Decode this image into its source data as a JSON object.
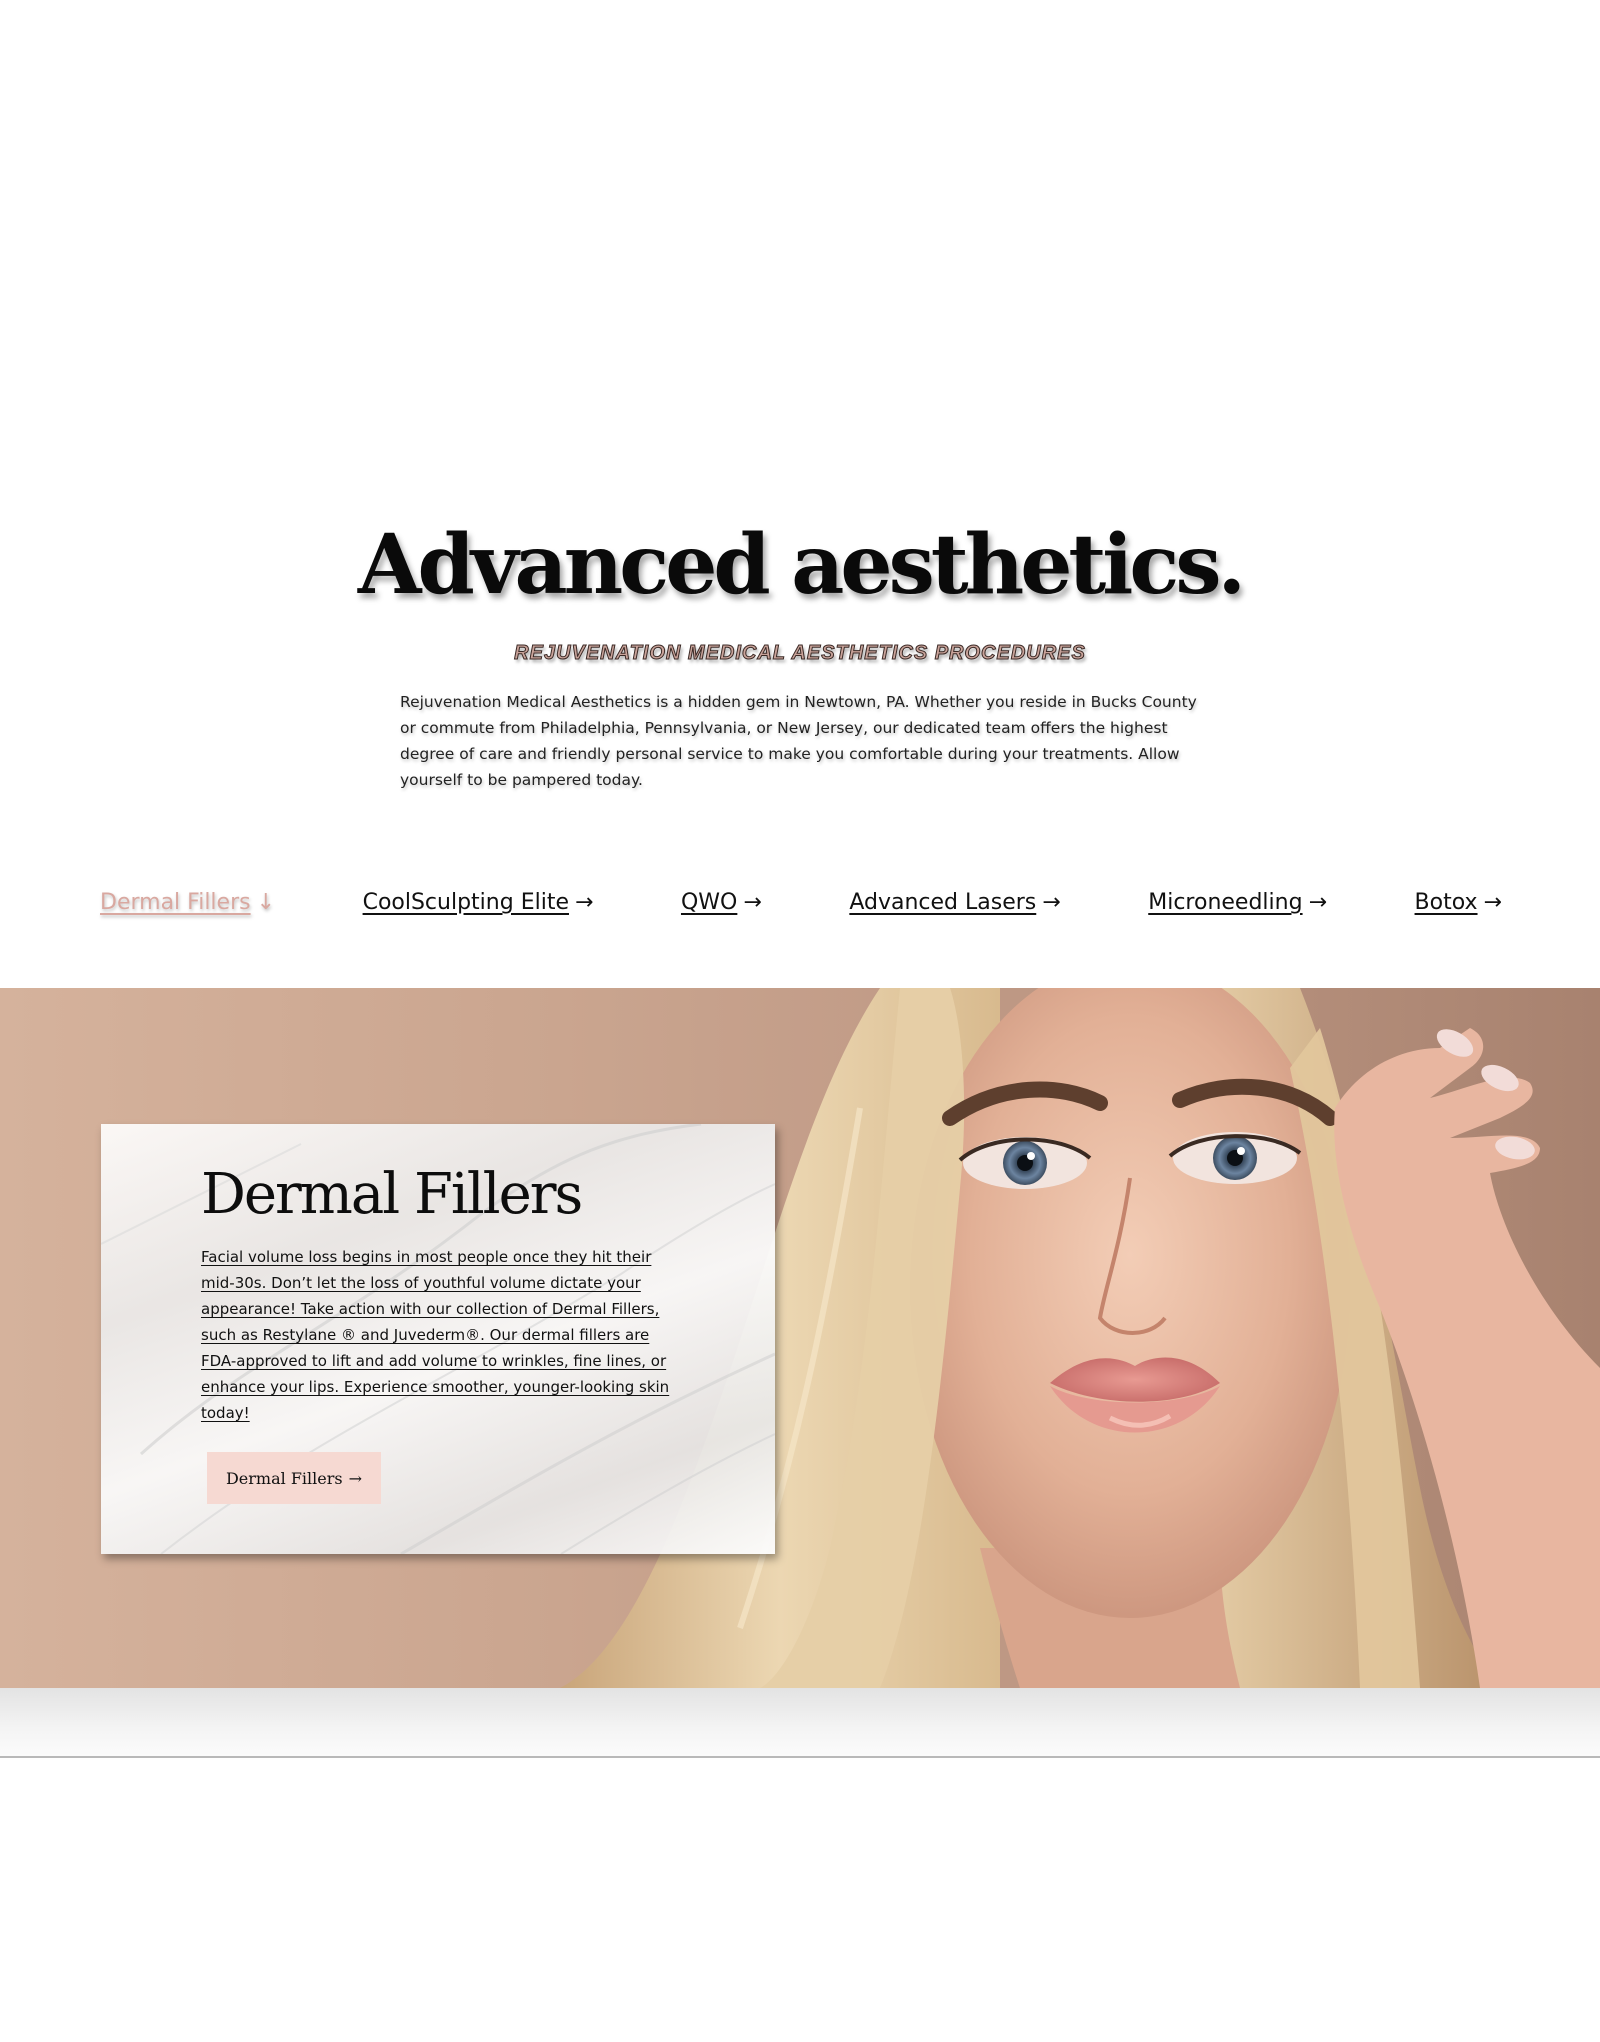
{
  "intro": {
    "headline": "Advanced aesthetics.",
    "subheading": "REJUVENATION MEDICAL AESTHETICS PROCEDURES",
    "paragraph": "Rejuvenation Medical Aesthetics is a hidden gem in Newtown, PA. Whether you reside in Bucks County or commute from Philadelphia, Pennsylvania, or New Jersey, our dedicated team offers the highest degree of care and friendly personal service to make you comfortable during your treatments. Allow yourself to be pampered today."
  },
  "procedures_nav": {
    "items": [
      {
        "label": "Dermal Fillers",
        "arrow": "↓",
        "active": true
      },
      {
        "label": "CoolSculpting Elite",
        "arrow": "→",
        "active": false
      },
      {
        "label": "QWO",
        "arrow": "→",
        "active": false
      },
      {
        "label": "Advanced Lasers",
        "arrow": "→",
        "active": false
      },
      {
        "label": "Microneedling",
        "arrow": "→",
        "active": false
      },
      {
        "label": "Botox",
        "arrow": "→",
        "active": false
      }
    ]
  },
  "feature": {
    "title": "Dermal Fillers",
    "body": "Facial volume loss begins in most people once they hit their mid-30s. Don’t let the loss of youthful volume dictate your appearance! Take action with our collection of Dermal Fillers, such as Restylane ® and Juvederm®. Our dermal fillers are FDA-approved to lift and add volume to wrinkles, fine lines, or enhance your lips. Experience smoother, younger-looking skin today!",
    "button_label": "Dermal Fillers",
    "button_arrow": "→"
  },
  "colors": {
    "accent_pink": "#f6d9d2",
    "active_link": "#d9a8a0",
    "hero_bg": "#caa58f"
  }
}
